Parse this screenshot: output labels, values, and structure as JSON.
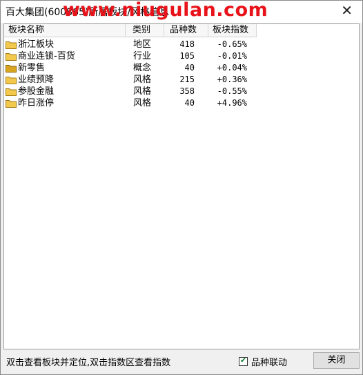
{
  "window": {
    "title": "百大集团(600865)所属板块/风格信息",
    "watermark": "www.niugulan.com",
    "close_glyph": "✕"
  },
  "table": {
    "columns": [
      "板块名称",
      "类别",
      "品种数",
      "板块指数"
    ],
    "rows": [
      {
        "name": "浙江板块",
        "category": "地区",
        "count": "418",
        "index": "-0.65%"
      },
      {
        "name": "商业连锁-百货",
        "category": "行业",
        "count": "105",
        "index": "-0.01%"
      },
      {
        "name": "新零售",
        "category": "概念",
        "count": "40",
        "index": "+0.04%"
      },
      {
        "name": "业绩预降",
        "category": "风格",
        "count": "215",
        "index": "+0.36%"
      },
      {
        "name": "参股金融",
        "category": "风格",
        "count": "358",
        "index": "-0.55%"
      },
      {
        "name": "昨日涨停",
        "category": "风格",
        "count": "40",
        "index": "+4.96%"
      }
    ],
    "row_icon": "folder-icon"
  },
  "footer": {
    "hint": "双击查看板块并定位,双击指数区查看指数",
    "linkage_label": "品种联动",
    "linkage_checked": true,
    "close_button": "关闭"
  },
  "colors": {
    "watermark": "#e8131a",
    "folder": "#f2c94c"
  }
}
